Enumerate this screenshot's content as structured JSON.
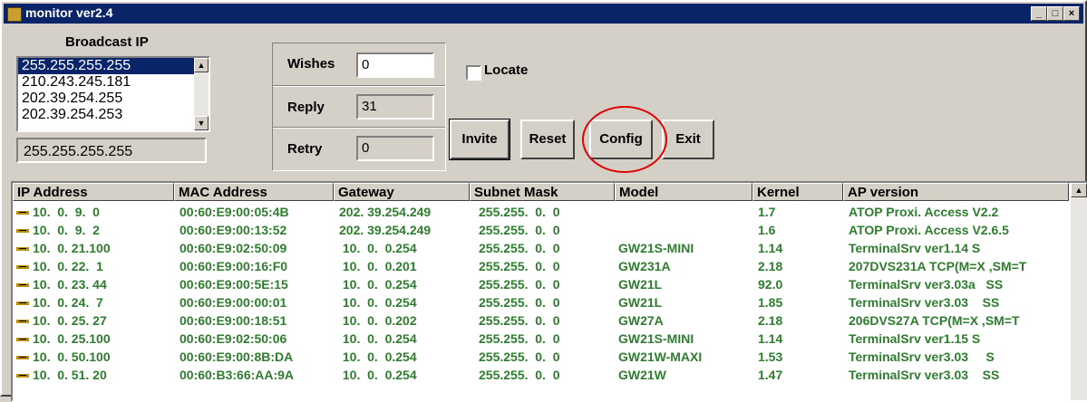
{
  "window": {
    "title": "monitor ver2.4"
  },
  "broadcast": {
    "label": "Broadcast IP",
    "items": [
      "255.255.255.255",
      "210.243.245.181",
      "202.39.254.255",
      "202.39.254.253"
    ],
    "selected": "255.255.255.255",
    "current": "255.255.255.255"
  },
  "counters": {
    "wishes_label": "Wishes",
    "wishes_value": "0",
    "reply_label": "Reply",
    "reply_value": "31",
    "retry_label": "Retry",
    "retry_value": "0"
  },
  "locate": {
    "label": "Locate",
    "checked": false
  },
  "buttons": {
    "invite": "Invite",
    "reset": "Reset",
    "config": "Config",
    "exit": "Exit"
  },
  "table": {
    "columns": [
      "IP Address",
      "MAC Address",
      "Gateway",
      "Subnet Mask",
      "Model",
      "Kernel",
      "AP version"
    ],
    "rows": [
      [
        "10.  0.  9.  0",
        "00:60:E9:00:05:4B",
        "202. 39.254.249",
        "255.255.  0.  0",
        "",
        "1.7",
        "ATOP Proxi. Access V2.2"
      ],
      [
        "10.  0.  9.  2",
        "00:60:E9:00:13:52",
        "202. 39.254.249",
        "255.255.  0.  0",
        "",
        "1.6",
        "ATOP Proxi. Access V2.6.5"
      ],
      [
        "10.  0. 21.100",
        "00:60:E9:02:50:09",
        " 10.  0.  0.254",
        "255.255.  0.  0",
        "GW21S-MINI",
        "1.14",
        "TerminalSrv ver1.14 S"
      ],
      [
        "10.  0. 22.  1",
        "00:60:E9:00:16:F0",
        " 10.  0.  0.201",
        "255.255.  0.  0",
        "GW231A",
        "2.18",
        "207DVS231A TCP(M=X ,SM=T"
      ],
      [
        "10.  0. 23. 44",
        "00:60:E9:00:5E:15",
        " 10.  0.  0.254",
        "255.255.  0.  0",
        "GW21L",
        "92.0",
        "TerminalSrv ver3.03a   SS"
      ],
      [
        "10.  0. 24.  7",
        "00:60:E9:00:00:01",
        " 10.  0.  0.254",
        "255.255.  0.  0",
        "GW21L",
        "1.85",
        "TerminalSrv ver3.03    SS"
      ],
      [
        "10.  0. 25. 27",
        "00:60:E9:00:18:51",
        " 10.  0.  0.202",
        "255.255.  0.  0",
        "GW27A",
        "2.18",
        "206DVS27A TCP(M=X ,SM=T"
      ],
      [
        "10.  0. 25.100",
        "00:60:E9:02:50:06",
        " 10.  0.  0.254",
        "255.255.  0.  0",
        "GW21S-MINI",
        "1.14",
        "TerminalSrv ver1.15 S"
      ],
      [
        "10.  0. 50.100",
        "00:60:E9:00:8B:DA",
        " 10.  0.  0.254",
        "255.255.  0.  0",
        "GW21W-MAXI",
        "1.53",
        "TerminalSrv ver3.03     S"
      ],
      [
        "10.  0. 51. 20",
        "00:60:B3:66:AA:9A",
        " 10.  0.  0.254",
        "255.255.  0.  0",
        "GW21W",
        "1.47",
        "TerminalSrv ver3.03    SS"
      ]
    ]
  },
  "icons": {
    "app": "app-icon",
    "row": "device-icon"
  },
  "colors": {
    "titlebar": "#0a246a",
    "row_text": "#2e7d2e",
    "highlight_circle": "#e00000"
  }
}
